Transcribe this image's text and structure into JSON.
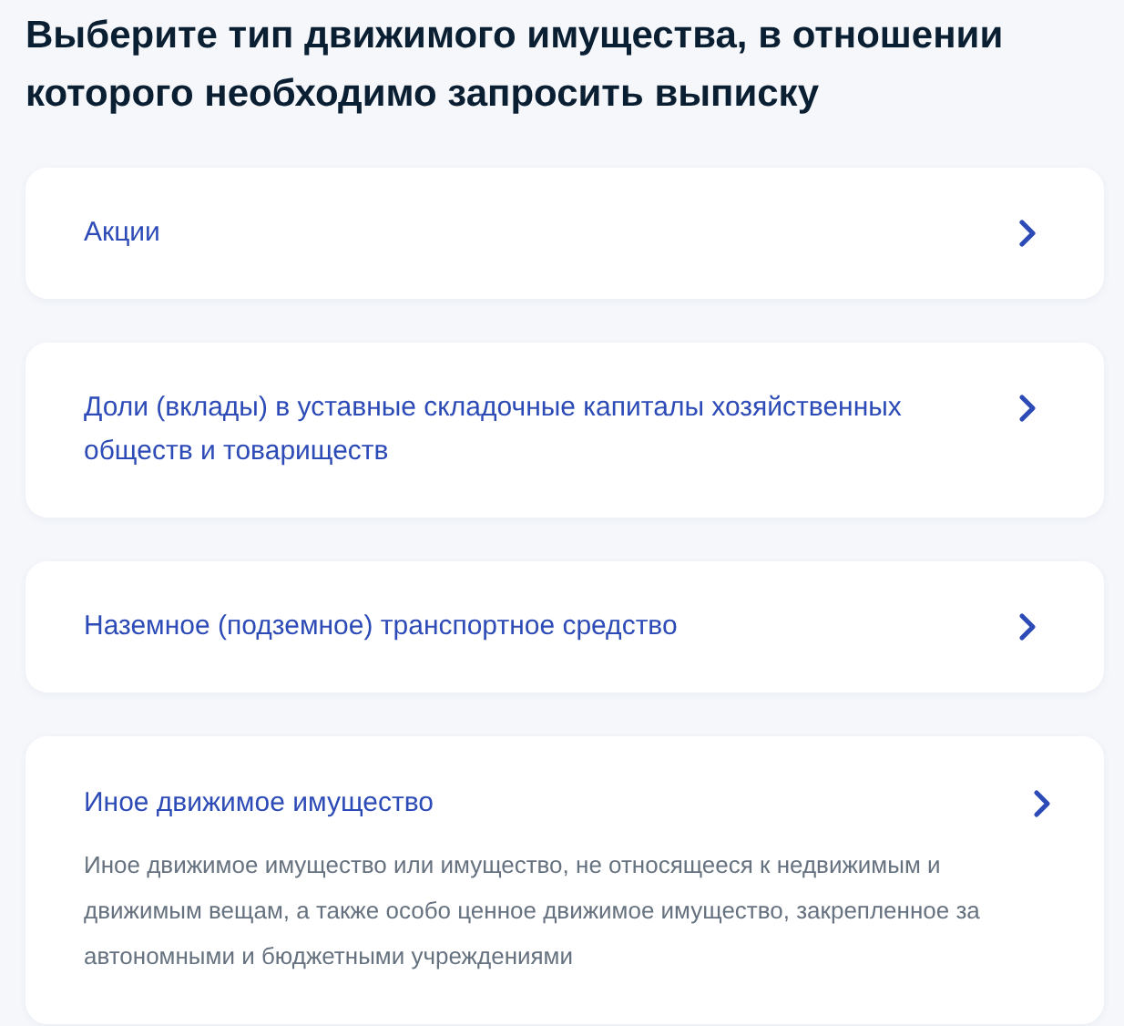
{
  "title": "Выберите тип движимого имущества, в отношении которого необходимо запросить выписку",
  "options": [
    {
      "label": "Акции"
    },
    {
      "label": "Доли (вклады) в уставные складочные капиталы хозяйственных обществ и товариществ"
    },
    {
      "label": "Наземное (подземное) транспортное средство"
    },
    {
      "label": "Иное движимое имущество",
      "description": "Иное движимое имущество или имущество, не относящееся к недвижимым и движимым вещам, а также особо ценное движимое имущество, закрепленное за автономными и бюджетными учреждениями"
    }
  ]
}
